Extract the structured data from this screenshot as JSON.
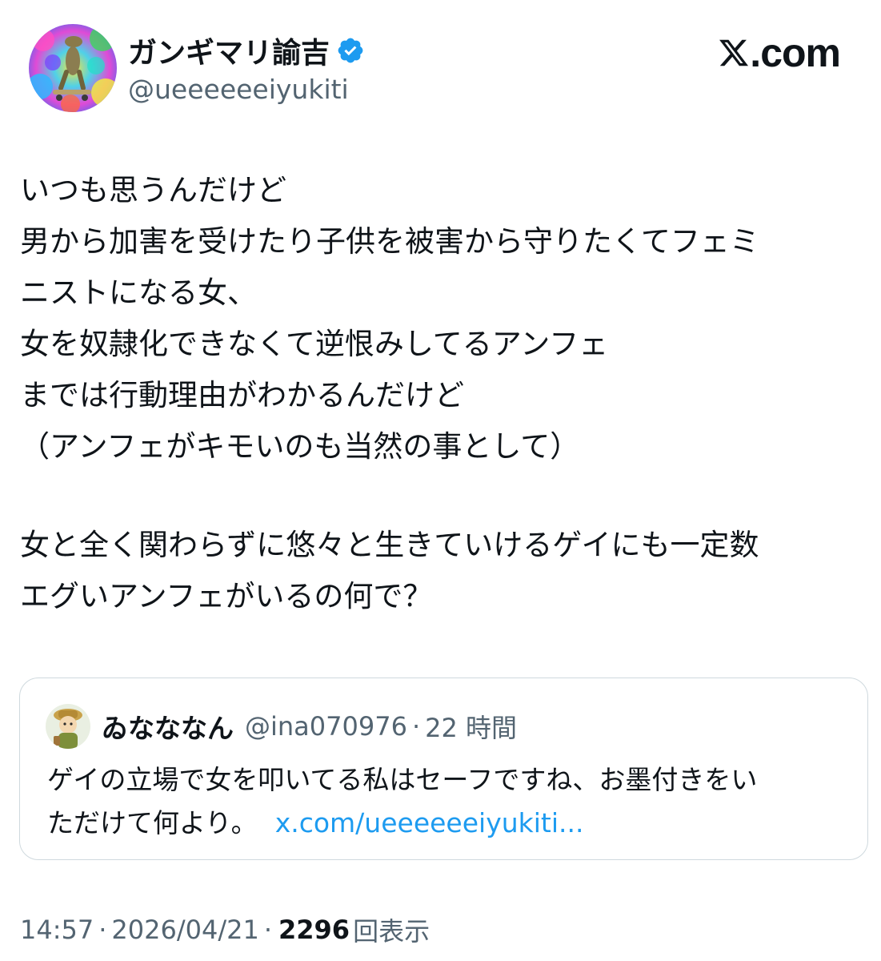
{
  "author": {
    "display_name": "ガンギマリ諭吉",
    "handle": "@ueeeeeeiyukiti",
    "verified": true,
    "avatar_icon": "frog-on-skateboard-avatar"
  },
  "brand": {
    "icon": "x-logo-icon",
    "domain_suffix": ".com"
  },
  "tweet": {
    "lines": [
      "いつも思うんだけど",
      "男から加害を受けたり子供を被害から守りたくてフェミ",
      "ニストになる女、",
      "女を奴隷化できなくて逆恨みしてるアンフェ",
      "までは行動理由がわかるんだけど",
      "（アンフェがキモいのも当然の事として）",
      "",
      "女と全く関わらずに悠々と生きていけるゲイにも一定数",
      "エグいアンフェがいるの何で？"
    ]
  },
  "quote": {
    "display_name": "ゐなななん",
    "handle": "@ina070976",
    "separator": "·",
    "time": "22 時間",
    "avatar_icon": "explorer-character-avatar",
    "text_line1": "ゲイの立場で女を叩いてる私はセーフですね、お墨付きをい",
    "text_line2": "ただけて何より。",
    "link": "x.com/ueeeeeeiyukiti..."
  },
  "footer": {
    "time": "14:57",
    "separator": "·",
    "date": "2026/04/21",
    "views_count": "2296",
    "views_label": "回表示"
  },
  "colors": {
    "text": "#0f1419",
    "secondary": "#536471",
    "link": "#1d9bf0",
    "verified": "#1d9bf0",
    "border": "#cfd9de"
  }
}
